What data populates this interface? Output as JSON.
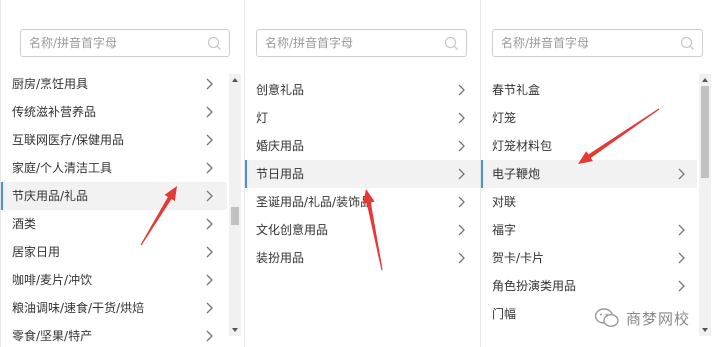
{
  "columns": [
    {
      "search_placeholder": "名称/拼音首字母",
      "items": [
        {
          "label": "厨房/烹饪用具",
          "has_children": true
        },
        {
          "label": "传统滋补营养品",
          "has_children": true
        },
        {
          "label": "互联网医疗/保健用品",
          "has_children": true
        },
        {
          "label": "家庭/个人清洁工具",
          "has_children": true
        },
        {
          "label": "节庆用品/礼品",
          "has_children": true,
          "selected": true
        },
        {
          "label": "酒类",
          "has_children": true
        },
        {
          "label": "居家日用",
          "has_children": true
        },
        {
          "label": "咖啡/麦片/冲饮",
          "has_children": true
        },
        {
          "label": "粮油调味/速食/干货/烘焙",
          "has_children": true
        },
        {
          "label": "零食/坚果/特产",
          "has_children": true
        }
      ],
      "scroll_position": 0.55
    },
    {
      "search_placeholder": "名称/拼音首字母",
      "items": [
        {
          "label": "创意礼品",
          "has_children": true
        },
        {
          "label": "灯",
          "has_children": true
        },
        {
          "label": "婚庆用品",
          "has_children": true
        },
        {
          "label": "节日用品",
          "has_children": true,
          "selected": true
        },
        {
          "label": "圣诞用品/礼品/装饰品",
          "has_children": true
        },
        {
          "label": "文化创意用品",
          "has_children": true
        },
        {
          "label": "装扮用品",
          "has_children": true
        }
      ]
    },
    {
      "search_placeholder": "名称/拼音首字母",
      "items": [
        {
          "label": "春节礼盒",
          "has_children": false
        },
        {
          "label": "灯笼",
          "has_children": false
        },
        {
          "label": "灯笼材料包",
          "has_children": false
        },
        {
          "label": "电子鞭炮",
          "has_children": true,
          "selected": true
        },
        {
          "label": "对联",
          "has_children": false
        },
        {
          "label": "福字",
          "has_children": true
        },
        {
          "label": "贺卡/卡片",
          "has_children": true
        },
        {
          "label": "角色扮演类用品",
          "has_children": true
        },
        {
          "label": "门幅",
          "has_children": false
        }
      ],
      "scroll_position": 0.0
    }
  ],
  "annotations": {
    "arrow_color": "#e53935"
  },
  "watermark": {
    "text": "商梦网校"
  },
  "colors": {
    "selected_bar": "#4a90d9",
    "selected_bg": "#f2f2f2",
    "text": "#333333"
  }
}
